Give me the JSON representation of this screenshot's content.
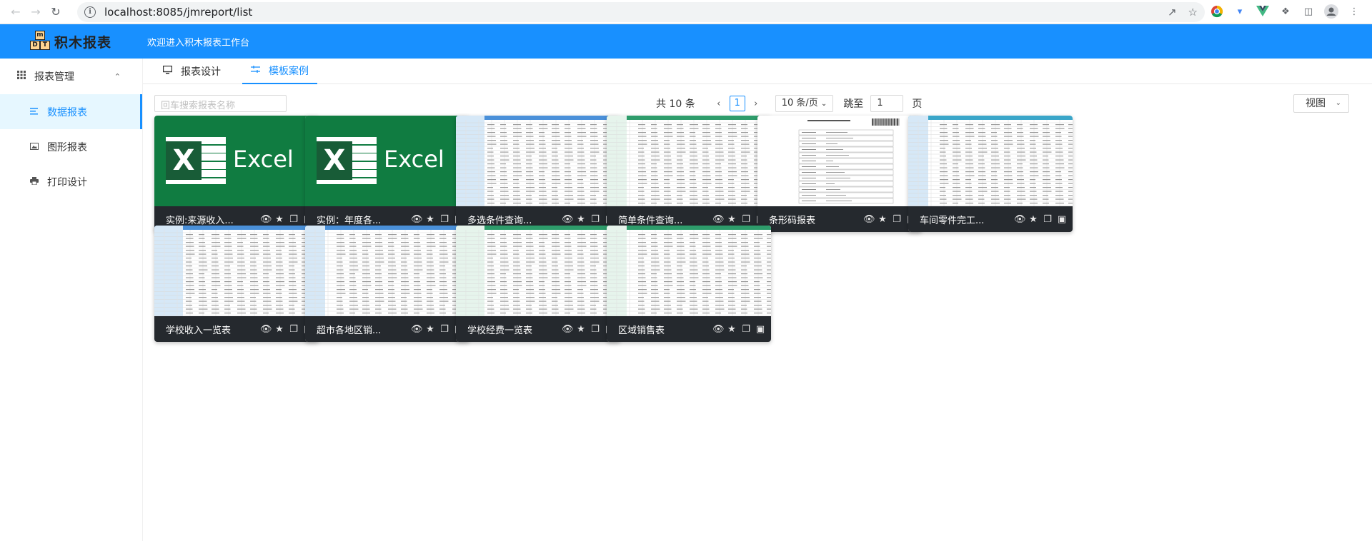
{
  "browser": {
    "url": "localhost:8085/jmreport/list"
  },
  "header": {
    "logo_badge": [
      "m",
      "D",
      "T"
    ],
    "logo_text": "积木报表",
    "welcome": "欢迎进入积木报表工作台"
  },
  "sidebar": {
    "group": {
      "label": "报表管理",
      "icon": "grid-icon"
    },
    "items": [
      {
        "label": "数据报表",
        "icon": "list-icon",
        "active": true
      },
      {
        "label": "图形报表",
        "icon": "image-icon",
        "active": false
      },
      {
        "label": "打印设计",
        "icon": "printer-icon",
        "active": false
      }
    ]
  },
  "tabs": [
    {
      "label": "报表设计",
      "icon": "monitor-icon",
      "active": false
    },
    {
      "label": "模板案例",
      "icon": "sliders-icon",
      "active": true
    }
  ],
  "search": {
    "placeholder": "回车搜索报表名称"
  },
  "pager": {
    "total": "共 10 条",
    "current": "1",
    "page_size": "10 条/页",
    "jump_label": "跳至",
    "jump_value": "1",
    "page_suffix": "页"
  },
  "view_button": "视图",
  "accent_color": "#1890ff",
  "cards": [
    {
      "title": "实例:来源收入...",
      "thumb": "excel"
    },
    {
      "title": "实例：年度各...",
      "thumb": "excel"
    },
    {
      "title": "多选条件查询...",
      "thumb": "sheet-blue"
    },
    {
      "title": "简单条件查询...",
      "thumb": "sheet-green"
    },
    {
      "title": "条形码报表",
      "thumb": "barcode"
    },
    {
      "title": "车间零件完工...",
      "thumb": "sheet-teal"
    },
    {
      "title": "学校收入一览表",
      "thumb": "sheet-blue"
    },
    {
      "title": "超市各地区销...",
      "thumb": "sheet-blue"
    },
    {
      "title": "学校经费一览表",
      "thumb": "sheet-green"
    },
    {
      "title": "区域销售表",
      "thumb": "sheet-green"
    }
  ],
  "excel_word": "Excel",
  "excel_letter": "X"
}
